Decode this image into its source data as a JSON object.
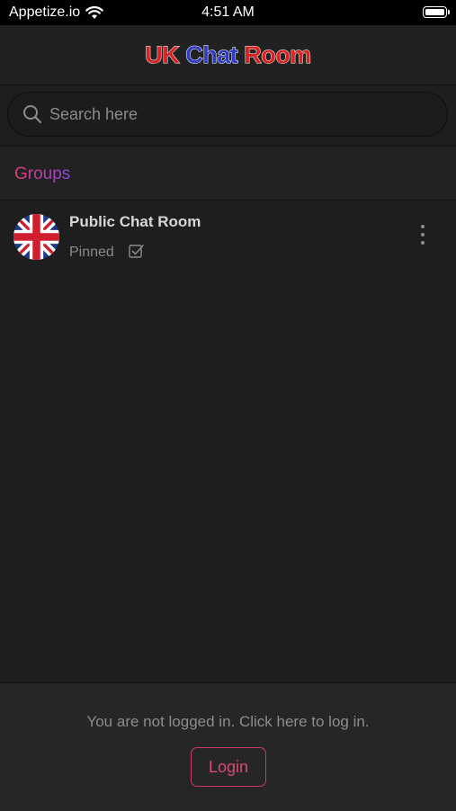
{
  "status_bar": {
    "carrier": "Appetize.io",
    "time": "4:51 AM"
  },
  "header": {
    "logo_uk": "UK",
    "logo_chat": "Chat",
    "logo_room": "Room"
  },
  "search": {
    "placeholder": "Search here"
  },
  "groups": {
    "title": "Groups",
    "items": [
      {
        "name": "Public Chat Room",
        "status": "Pinned",
        "flag_icon": "uk-flag-icon"
      }
    ]
  },
  "footer": {
    "prompt": "You are not logged in. Click here to log in.",
    "login_label": "Login"
  },
  "colors": {
    "accent_pink": "#d94a72",
    "accent_purple": "#8f47d9",
    "logo_red": "#d42424",
    "logo_blue": "#2f3cc0"
  }
}
